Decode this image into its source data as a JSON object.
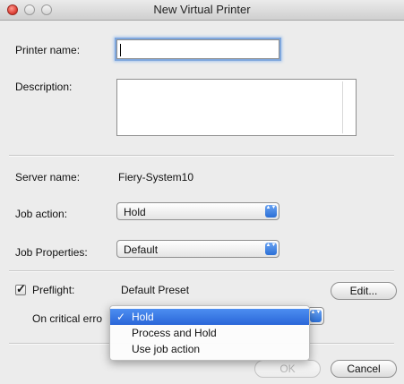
{
  "window": {
    "title": "New Virtual Printer"
  },
  "form": {
    "printer_name_label": "Printer name:",
    "printer_name_value": "",
    "description_label": "Description:",
    "description_value": "",
    "server_name_label": "Server name:",
    "server_name_value": "Fiery-System10",
    "job_action_label": "Job action:",
    "job_action_value": "Hold",
    "job_properties_label": "Job Properties:",
    "job_properties_value": "Default"
  },
  "preflight": {
    "label": "Preflight:",
    "checked": true,
    "check_glyph": "✓",
    "preset_value": "Default Preset",
    "edit_label": "Edit...",
    "critical_error_label": "On critical erro",
    "menu": {
      "check_glyph": "✓",
      "items": [
        "Hold",
        "Process and Hold",
        "Use job action"
      ],
      "selected": "Hold"
    }
  },
  "buttons": {
    "ok": "OK",
    "cancel": "Cancel"
  },
  "icons": {
    "popup_arrows": "▲▼"
  }
}
